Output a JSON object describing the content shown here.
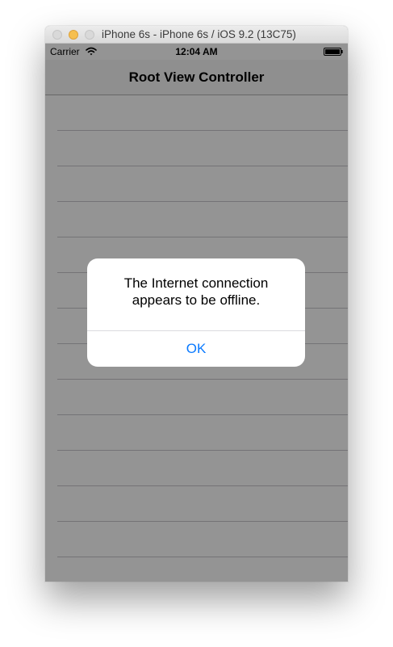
{
  "window": {
    "title": "iPhone 6s - iPhone 6s / iOS 9.2 (13C75)"
  },
  "status_bar": {
    "carrier": "Carrier",
    "time": "12:04 AM",
    "wifi_icon": "wifi-icon",
    "battery_icon": "battery-icon"
  },
  "nav_bar": {
    "title": "Root View Controller"
  },
  "table": {
    "row_count": 14
  },
  "alert": {
    "message": "The Internet connection appears to be offline.",
    "ok_label": "OK"
  },
  "colors": {
    "tint": "#0a7aff",
    "dim_overlay": "rgba(0,0,0,0.42)"
  }
}
